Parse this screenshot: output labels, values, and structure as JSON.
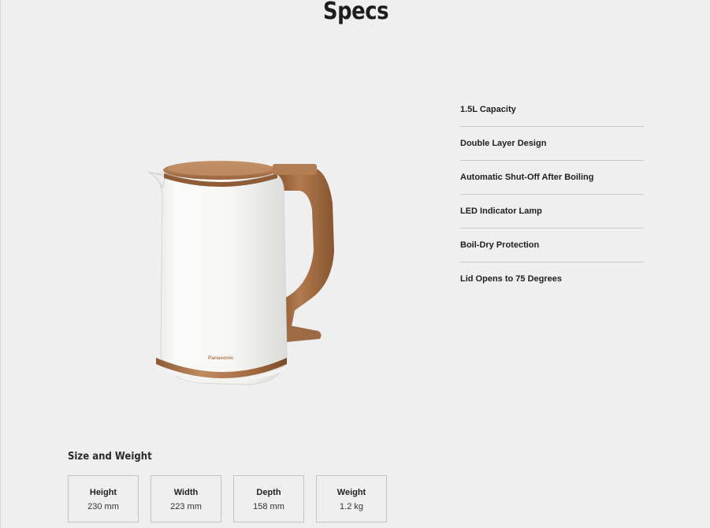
{
  "page": {
    "title": "Specs"
  },
  "product": {
    "brand": "Panasonic",
    "colors": {
      "body": "#f7f7f5",
      "accent": "#b07a52",
      "handle": "#a0683e"
    }
  },
  "specs": [
    {
      "label": "1.5L Capacity"
    },
    {
      "label": "Double Layer Design"
    },
    {
      "label": "Automatic Shut-Off After Boiling"
    },
    {
      "label": "LED Indicator Lamp"
    },
    {
      "label": "Boil-Dry Protection"
    },
    {
      "label": "Lid Opens to 75 Degrees"
    }
  ],
  "size_weight": {
    "heading": "Size and Weight",
    "items": [
      {
        "label": "Height",
        "value": "230 mm"
      },
      {
        "label": "Width",
        "value": "223 mm"
      },
      {
        "label": "Depth",
        "value": "158 mm"
      },
      {
        "label": "Weight",
        "value": "1.2 kg"
      }
    ]
  }
}
